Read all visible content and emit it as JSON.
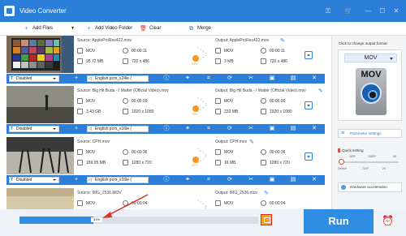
{
  "titlebar": {
    "title": "Video Converter",
    "icons": [
      "key-icon",
      "cart-icon",
      "minimize-icon",
      "maximize-icon",
      "close-icon"
    ]
  },
  "toolbar": {
    "add_files": "Add Files",
    "add_folder": "Add Video Folder",
    "clear": "Clear",
    "merge": "Merge"
  },
  "files": [
    {
      "source": "Source: AppleProRes422.mov",
      "output": "Output: AppleProRes422.mov",
      "src_format": "MOV",
      "src_duration": "00:00:11",
      "src_size": "95.72 MB",
      "src_res": "720 x 486",
      "out_format": "MOV",
      "out_duration": "00:00:11",
      "out_size": "3 MB",
      "out_res": "720 x 486",
      "subtitle": "Disabled",
      "audio": "English pcm_s24le ("
    },
    {
      "source": "Source: Big Hit Buda - I Matter (Official Video).mov",
      "output": "Output: Big Hit Buda - I Matter (Official Video).mov",
      "src_format": "MOV",
      "src_duration": "00:05:00",
      "src_size": "3.43 GB",
      "src_res": "1920 x 1080",
      "out_format": "MOV",
      "out_duration": "00:05:00",
      "out_size": "233 MB",
      "out_res": "1920 x 1080",
      "subtitle": "Disabled",
      "audio": "English pcm_s16le ("
    },
    {
      "source": "Source: CPH.mov",
      "output": "Output: CPH.mov",
      "src_format": "MOV",
      "src_duration": "00:00:36",
      "src_size": "159.95 MB",
      "src_res": "1280 x 720",
      "out_format": "MOV",
      "out_duration": "00:00:36",
      "out_size": "16 MB",
      "out_res": "1280 x 720",
      "subtitle": "Disabled",
      "audio": "English pcm_s16le ("
    },
    {
      "source": "Source: IMG_2536.MOV",
      "output": "Output: IMG_2536.mov",
      "src_format": "MOV",
      "src_duration": "00:00:04",
      "src_size": "",
      "src_res": "",
      "out_format": "MOV",
      "out_duration": "00:00:04",
      "out_size": "",
      "out_res": "",
      "subtitle": "",
      "audio": ""
    }
  ],
  "gpu_label": "GPU",
  "rightpanel": {
    "title": "Click to change output format",
    "format": "MOV",
    "format_icon_label": "MOV",
    "param_settings": "Parameter settings",
    "quick_setting": "Quick setting",
    "res_marks": [
      "480P",
      "1080P",
      "4K"
    ],
    "quality_labels": [
      "Default",
      "720P",
      "2K"
    ],
    "hw_accel": "Hardware acceleration"
  },
  "bottom": {
    "progress_text": "31%",
    "progress_value": 0.31,
    "run": "Run"
  },
  "colors": {
    "accent": "#2b7fd8",
    "run": "#2e8de3",
    "highlight": "#d93025"
  }
}
